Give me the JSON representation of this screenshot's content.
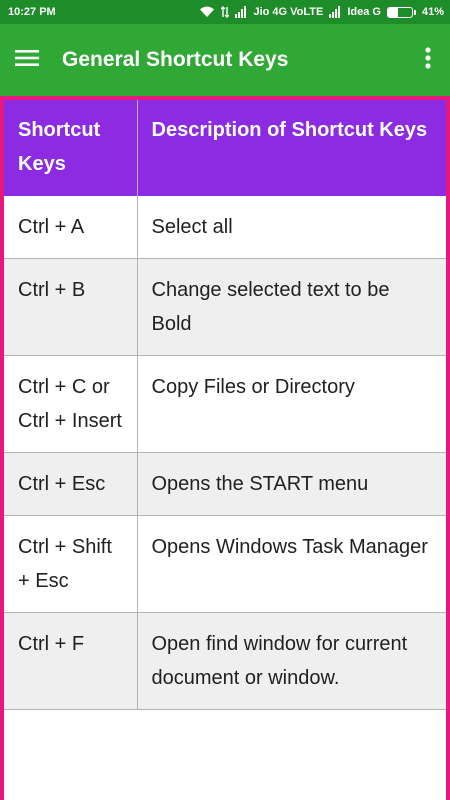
{
  "status_bar": {
    "time": "10:27 PM",
    "carrier1": "Jio 4G VoLTE",
    "carrier2": "Idea G",
    "battery": "41%",
    "battery_level": 0.41,
    "icons": [
      "wifi-icon",
      "signal-icon",
      "data-icon",
      "battery-icon"
    ]
  },
  "app_bar": {
    "title": "General Shortcut Keys",
    "menu_icon": "hamburger-menu-icon",
    "overflow_icon": "more-vert-icon",
    "color": "#2fa836"
  },
  "table": {
    "headers": [
      "Shortcut Keys",
      "Description of Shortcut Keys"
    ],
    "header_color": "#8c2be2",
    "frame_color": "#e8177f",
    "rows": [
      {
        "keys": "Ctrl + A",
        "description": "Select all"
      },
      {
        "keys": "Ctrl + B",
        "description": "Change selected text to be Bold"
      },
      {
        "keys": "Ctrl + C or Ctrl + Insert",
        "description": "Copy Files or Directory"
      },
      {
        "keys": "Ctrl + Esc",
        "description": "Opens the START menu"
      },
      {
        "keys": "Ctrl + Shift + Esc",
        "description": "Opens Windows Task Manager"
      },
      {
        "keys": "Ctrl + F",
        "description": "Open find window for current document or window."
      }
    ]
  }
}
